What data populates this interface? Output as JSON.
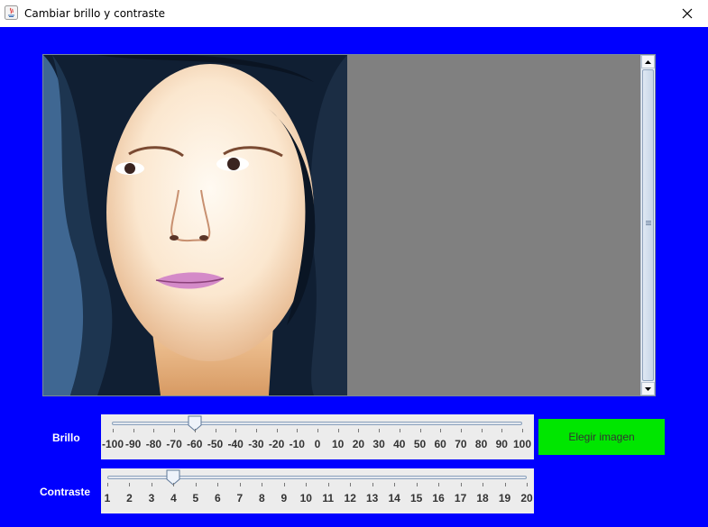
{
  "window": {
    "title": "Cambiar brillo y contraste"
  },
  "brillo": {
    "label": "Brillo",
    "value": -60,
    "min": -100,
    "max": 100,
    "tick_labels": [
      "-100",
      "-90",
      "-80",
      "-70",
      "-60",
      "-50",
      "-40",
      "-30",
      "-20",
      "-10",
      "0",
      "10",
      "20",
      "30",
      "40",
      "50",
      "60",
      "70",
      "80",
      "90",
      "100"
    ]
  },
  "contraste": {
    "label": "Contraste",
    "value": 4,
    "min": 1,
    "max": 20,
    "tick_labels": [
      "1",
      "2",
      "3",
      "4",
      "5",
      "6",
      "7",
      "8",
      "9",
      "10",
      "11",
      "12",
      "13",
      "14",
      "15",
      "16",
      "17",
      "18",
      "19",
      "20"
    ]
  },
  "button": {
    "label": "Elegir imagen"
  },
  "colors": {
    "background": "#0000ff",
    "button": "#00e600",
    "viewer": "#808080"
  }
}
